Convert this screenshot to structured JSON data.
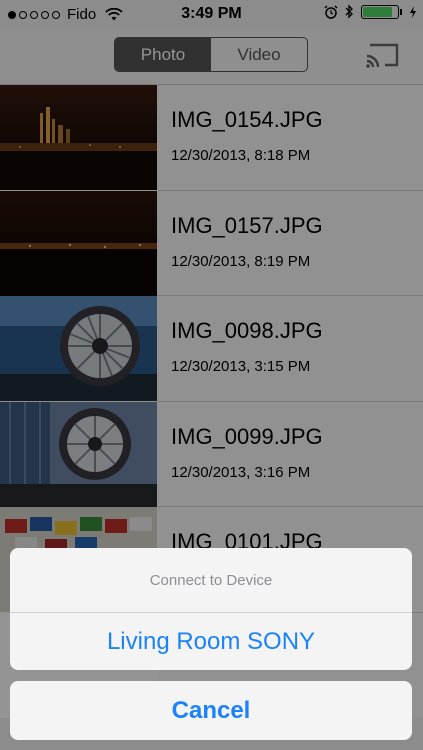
{
  "status_bar": {
    "carrier": "Fido",
    "time": "3:49 PM",
    "battery_level": 0.85
  },
  "media_toggle": {
    "photo_label": "Photo",
    "video_label": "Video",
    "selected": "Photo"
  },
  "photos": [
    {
      "name": "IMG_0154.JPG",
      "date": "12/30/2013, 8:18 PM"
    },
    {
      "name": "IMG_0157.JPG",
      "date": "12/30/2013, 8:19 PM"
    },
    {
      "name": "IMG_0098.JPG",
      "date": "12/30/2013, 3:15 PM"
    },
    {
      "name": "IMG_0099.JPG",
      "date": "12/30/2013, 3:16 PM"
    },
    {
      "name": "IMG_0101.JPG",
      "date": ""
    }
  ],
  "action_sheet": {
    "title": "Connect to Device",
    "device_option": "Living Room SONY",
    "cancel_label": "Cancel"
  },
  "colors": {
    "accent": "#1a82fb",
    "segment_active": "#555555"
  }
}
